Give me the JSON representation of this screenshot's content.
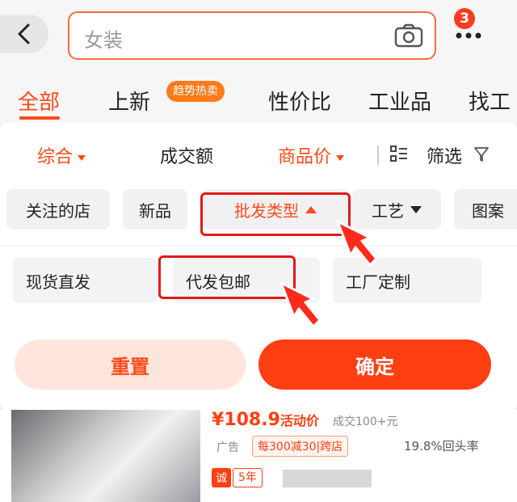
{
  "search": {
    "placeholder": "女装",
    "badge_count": "3"
  },
  "category_tabs": [
    {
      "label": "全部",
      "active": true
    },
    {
      "label": "上新"
    },
    {
      "label": "性价比"
    },
    {
      "label": "工业品"
    },
    {
      "label": "找工"
    }
  ],
  "hot_badge": "趋势热卖",
  "sort_bar": {
    "comprehensive": "综合",
    "volume": "成交额",
    "price": "商品价",
    "filter": "筛选"
  },
  "filter_chips": [
    {
      "label": "关注的店"
    },
    {
      "label": "新品"
    },
    {
      "label": "批发类型",
      "active": true
    },
    {
      "label": "工艺"
    },
    {
      "label": "图案"
    }
  ],
  "options": [
    "现货直发",
    "代发包邮",
    "工厂定制"
  ],
  "buttons": {
    "reset": "重置",
    "confirm": "确定"
  },
  "product": {
    "price": "¥108.9",
    "price_tag": "活动价",
    "sold": "成交100+元",
    "ad": "广告",
    "promo": "每300减30|跨店",
    "repeat": "19.8%回头率",
    "cheng": "诚",
    "years": "5年"
  },
  "colors": {
    "accent": "#ff4a1a",
    "highlight": "#e01a1a"
  }
}
